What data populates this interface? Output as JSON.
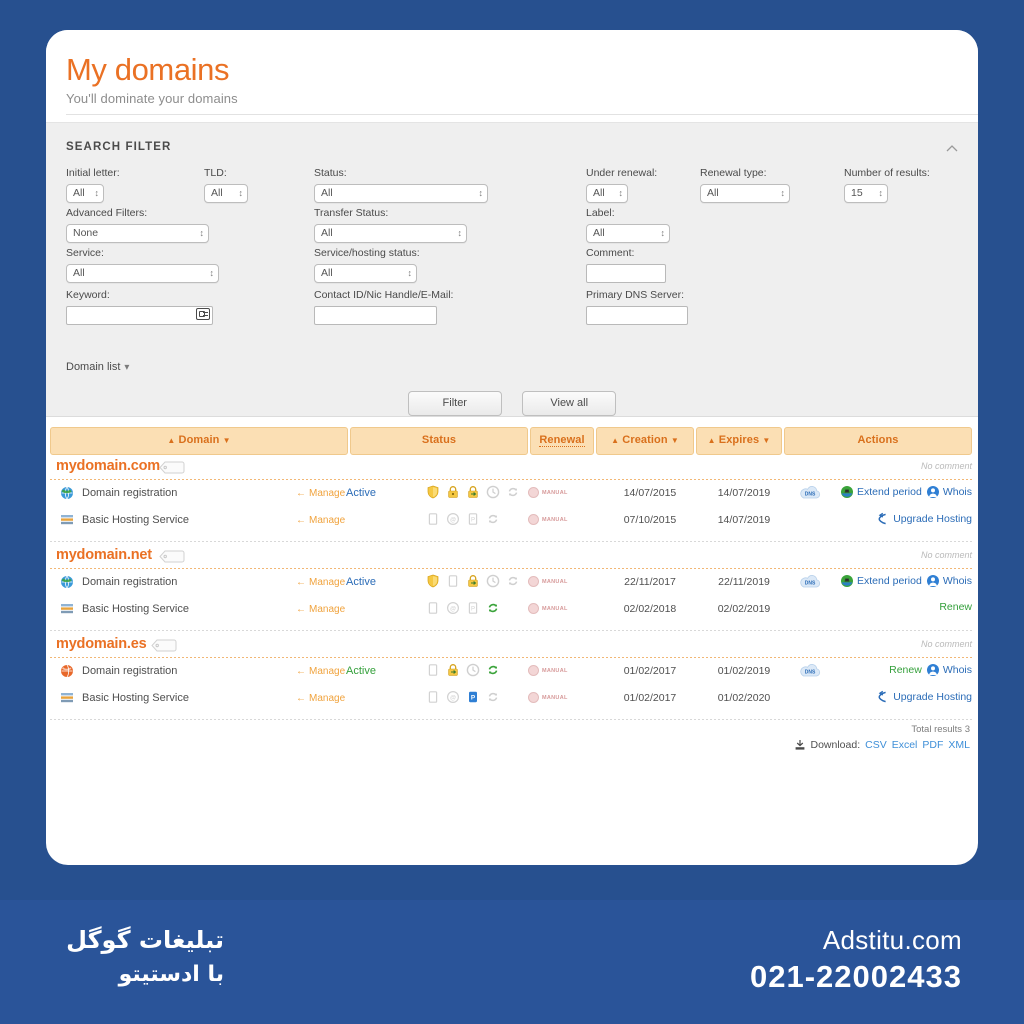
{
  "app": {
    "title": "My domains",
    "subtitle": "You'll dominate your domains"
  },
  "filter": {
    "heading": "SEARCH FILTER",
    "collapse_icon": "chevron-up-icon",
    "fields": [
      {
        "label": "Initial letter:",
        "value": "All",
        "type": "select"
      },
      {
        "label": "TLD:",
        "value": "All",
        "type": "select"
      },
      {
        "label": "Status:",
        "value": "All",
        "type": "select"
      },
      {
        "label": "Under renewal:",
        "value": "All",
        "type": "select"
      },
      {
        "label": "Renewal type:",
        "value": "All",
        "type": "select"
      },
      {
        "label": "Number of results:",
        "value": "15",
        "type": "select"
      },
      {
        "label": "Advanced Filters:",
        "value": "None",
        "type": "select"
      },
      {
        "label": "Transfer Status:",
        "value": "All",
        "type": "select"
      },
      {
        "label": "Label:",
        "value": "All",
        "type": "select"
      },
      {
        "label": "Service:",
        "value": "All",
        "type": "select"
      },
      {
        "label": "Service/hosting status:",
        "value": "All",
        "type": "select"
      },
      {
        "label": "Comment:",
        "value": "",
        "type": "text"
      },
      {
        "label": "Keyword:",
        "value": "",
        "type": "text"
      },
      {
        "label": "Contact ID/Nic Handle/E-Mail:",
        "value": "",
        "type": "text"
      },
      {
        "label": "Primary DNS Server:",
        "value": "",
        "type": "text"
      }
    ],
    "domain_list_toggle": "Domain list",
    "buttons": {
      "filter": "Filter",
      "view_all": "View all"
    }
  },
  "table": {
    "headers": {
      "domain": "Domain",
      "status": "Status",
      "renewal": "Renewal",
      "creation": "Creation",
      "expires": "Expires",
      "actions": "Actions"
    },
    "no_comment": "No comment",
    "groups": [
      {
        "domain": "mydomain.com",
        "rows": [
          {
            "service": "Domain registration",
            "service_icon": "globe-icon",
            "manage": "Manage",
            "status": "Active",
            "status_color": "#2b6cb7",
            "renewal": "MANUAL",
            "creation": "14/07/2015",
            "expires": "14/07/2019",
            "dns_badge": "DNS",
            "actions": [
              {
                "label": "Extend period",
                "icon": "extend-icon",
                "color": "blue"
              },
              {
                "label": "Whois",
                "icon": "whois-icon",
                "color": "blue"
              }
            ]
          },
          {
            "service": "Basic Hosting Service",
            "service_icon": "hosting-icon",
            "manage": "Manage",
            "status": "",
            "status_color": "#2b6cb7",
            "renewal": "MANUAL",
            "creation": "07/10/2015",
            "expires": "14/07/2019",
            "dns_badge": "",
            "actions": [
              {
                "label": "Upgrade Hosting",
                "icon": "upgrade-icon",
                "color": "blue"
              }
            ]
          }
        ]
      },
      {
        "domain": "mydomain.net",
        "rows": [
          {
            "service": "Domain registration",
            "service_icon": "globe-icon",
            "manage": "Manage",
            "status": "Active",
            "status_color": "#2b6cb7",
            "renewal": "MANUAL",
            "creation": "22/11/2017",
            "expires": "22/11/2019",
            "dns_badge": "DNS",
            "actions": [
              {
                "label": "Extend period",
                "icon": "extend-icon",
                "color": "blue"
              },
              {
                "label": "Whois",
                "icon": "whois-icon",
                "color": "blue"
              }
            ]
          },
          {
            "service": "Basic Hosting Service",
            "service_icon": "hosting-icon",
            "manage": "Manage",
            "status": "",
            "status_color": "#2b6cb7",
            "renewal": "MANUAL",
            "creation": "02/02/2018",
            "expires": "02/02/2019",
            "dns_badge": "",
            "actions": [
              {
                "label": "Renew",
                "icon": "renew-icon",
                "color": "green"
              }
            ]
          }
        ]
      },
      {
        "domain": "mydomain.es",
        "rows": [
          {
            "service": "Domain registration",
            "service_icon": "globe-orange-icon",
            "manage": "Manage",
            "status": "Active",
            "status_color": "#35a03c",
            "renewal": "MANUAL",
            "creation": "01/02/2017",
            "expires": "01/02/2019",
            "dns_badge": "DNS",
            "actions": [
              {
                "label": "Renew",
                "icon": "renew-icon",
                "color": "green"
              },
              {
                "label": "Whois",
                "icon": "whois-icon",
                "color": "blue"
              }
            ]
          },
          {
            "service": "Basic Hosting Service",
            "service_icon": "hosting-icon",
            "manage": "Manage",
            "status": "",
            "status_color": "#2b6cb7",
            "renewal": "MANUAL",
            "creation": "01/02/2017",
            "expires": "01/02/2020",
            "dns_badge": "",
            "actions": [
              {
                "label": "Upgrade Hosting",
                "icon": "upgrade-icon",
                "color": "blue"
              }
            ]
          }
        ]
      }
    ],
    "footer": {
      "total": "Total results 3",
      "download_label": "Download:",
      "formats": [
        "CSV",
        "Excel",
        "PDF",
        "XML"
      ]
    }
  },
  "banner": {
    "fa_line1": "تبلیغات گوگل",
    "fa_line2": "با ادستیتو",
    "site": "Adstitu.com",
    "phone": "021-22002433"
  },
  "colors": {
    "background": "#27508f",
    "brand_orange": "#ea7124",
    "header_bg": "#fbdfb4",
    "link_blue": "#2b6cb7",
    "green": "#35a03c"
  }
}
